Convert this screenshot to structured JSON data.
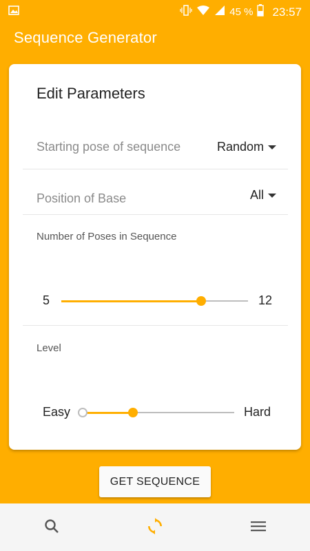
{
  "status_bar": {
    "battery_percent": "45 %",
    "time": "23:57",
    "icons": [
      "image-icon",
      "vibrate-icon",
      "wifi-icon",
      "signal-icon",
      "battery-icon"
    ]
  },
  "app_bar": {
    "title": "Sequence Generator"
  },
  "card": {
    "title": "Edit Parameters",
    "starting_pose": {
      "label": "Starting pose of sequence",
      "value": "Random"
    },
    "position_of_base": {
      "label": "Position of Base",
      "value": "All"
    },
    "poses_count": {
      "label": "Number of Poses in Sequence",
      "min": "5",
      "max": "12",
      "fraction": 0.75
    },
    "level": {
      "label": "Level",
      "min": "Easy",
      "max": "Hard",
      "fraction": 0.33
    }
  },
  "get_sequence_button": {
    "label": "GET SEQUENCE"
  },
  "bottom_nav": {
    "items": [
      {
        "icon": "search-icon",
        "active": false
      },
      {
        "icon": "refresh-icon",
        "active": true
      },
      {
        "icon": "menu-icon",
        "active": false
      }
    ]
  },
  "colors": {
    "accent": "#ffae00",
    "track": "#bdbdbd",
    "nav_bg": "#f5f5f5"
  }
}
